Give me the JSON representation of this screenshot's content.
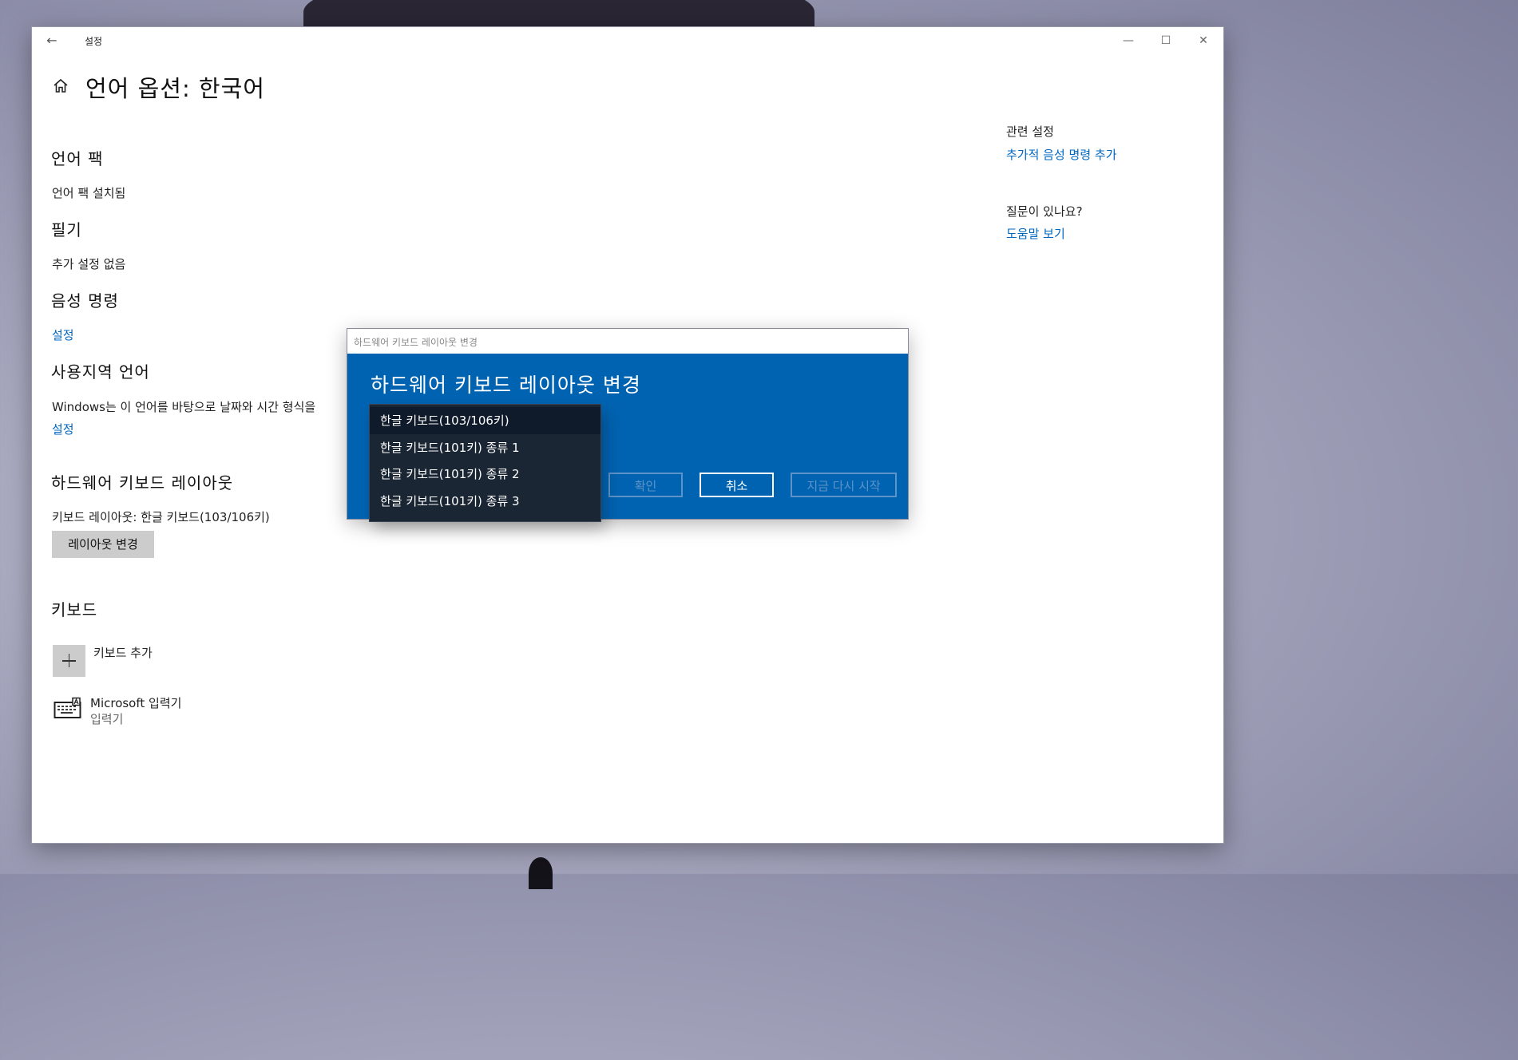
{
  "window": {
    "app_title": "설정",
    "page_title": "언어 옵션: 한국어",
    "controls": {
      "minimize": "—",
      "maximize": "☐",
      "close": "✕"
    }
  },
  "sections": {
    "language_pack": {
      "heading": "언어 팩",
      "status": "언어 팩 설치됨"
    },
    "handwriting": {
      "heading": "필기",
      "status": "추가 설정 없음"
    },
    "speech": {
      "heading": "음성 명령",
      "link": "설정"
    },
    "regional": {
      "heading": "사용지역 언어",
      "description": "Windows는 이 언어를 바탕으로 날짜와 시간 형식을 ",
      "link": "설정"
    },
    "hardware_keyboard": {
      "heading": "하드웨어 키보드 레이아웃",
      "current": "키보드 레이아웃: 한글 키보드(103/106키)",
      "change_button": "레이아웃 변경"
    },
    "keyboards": {
      "heading": "키보드",
      "add_label": "키보드 추가",
      "ime_name": "Microsoft 입력기",
      "ime_type": "입력기"
    }
  },
  "sidebar": {
    "related_heading": "관련 설정",
    "related_link": "추가적 음성 명령 추가",
    "question_heading": "질문이 있나요?",
    "help_link": "도움말 보기"
  },
  "dialog": {
    "title_bar": "하드웨어 키보드 레이아웃 변경",
    "heading": "하드웨어 키보드 레이아웃 변경",
    "buttons": {
      "ok": "확인",
      "cancel": "취소",
      "restart": "지금 다시 시작"
    },
    "options": [
      "한글 키보드(103/106키)",
      "한글 키보드(101키) 종류 1",
      "한글 키보드(101키) 종류 2",
      "한글 키보드(101키) 종류 3"
    ],
    "selected_index": 0
  },
  "colors": {
    "accent": "#0063b1",
    "link": "#0067c0",
    "dropdown_bg": "#1b2635"
  }
}
